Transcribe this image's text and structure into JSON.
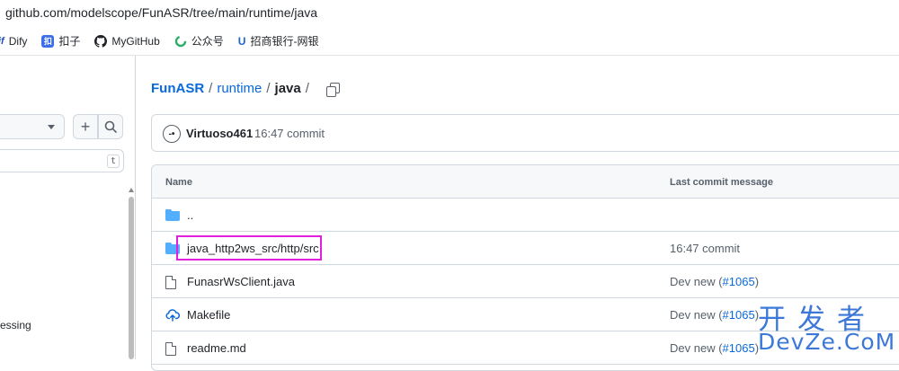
{
  "browser": {
    "url": "github.com/modelscope/FunASR/tree/main/runtime/java",
    "bookmarks": [
      {
        "label": "Dify",
        "icon_text": "if",
        "icon": "dify-icon"
      },
      {
        "label": "扣子",
        "icon_text": "扣",
        "icon": "kouzi-icon"
      },
      {
        "label": "MyGitHub",
        "icon": "github-icon"
      },
      {
        "label": "公众号",
        "icon": "wechat-official-icon"
      },
      {
        "label": "招商银行-网银",
        "icon_text": "U",
        "icon": "bank-icon"
      }
    ]
  },
  "sidebar": {
    "filter_shortcut": "t",
    "partial_item": "essing"
  },
  "breadcrumb": {
    "repo": "FunASR",
    "sep": "/",
    "folder": "runtime",
    "current": "java",
    "trail_sep": "/"
  },
  "latest_commit": {
    "avatar_text": "-•",
    "user": "Virtuoso461",
    "message": "16:47 commit"
  },
  "file_table": {
    "headers": {
      "name": "Name",
      "message": "Last commit message"
    },
    "rows": [
      {
        "name": "..",
        "type": "folder",
        "message": "",
        "pr": ""
      },
      {
        "name": "java_http2ws_src/http/src",
        "type": "folder",
        "message": "16:47 commit",
        "pr": "",
        "highlighted": true
      },
      {
        "name": "FunasrWsClient.java",
        "type": "file",
        "message": "Dev new (",
        "pr": "#1065",
        "message_end": ")"
      },
      {
        "name": "Makefile",
        "type": "cloud",
        "message": "Dev new (",
        "pr": "#1065",
        "message_end": ")"
      },
      {
        "name": "readme.md",
        "type": "file",
        "message": "Dev new (",
        "pr": "#1065",
        "message_end": ")"
      }
    ]
  },
  "watermark": {
    "cn": "开发者",
    "en": "DevZe.CoM"
  },
  "colors": {
    "link": "#0969da",
    "highlight": "#e21fdc",
    "folder": "#54aeff",
    "watermark": "#3b78d8"
  }
}
